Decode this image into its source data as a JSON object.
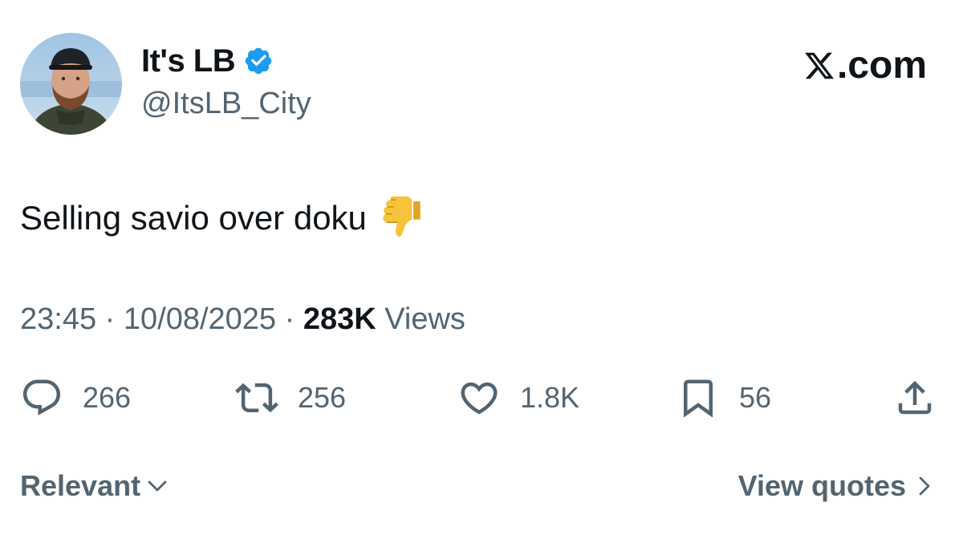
{
  "author": {
    "display_name": "It's LB",
    "handle": "@ItsLB_City",
    "verified": true,
    "avatar_icon": "profile-photo"
  },
  "brand": {
    "label": ".com",
    "logo_icon": "x-logo-icon"
  },
  "tweet": {
    "text": "Selling savio over doku",
    "emoji_icon": "thumbs-down-emoji-icon"
  },
  "meta": {
    "time": "23:45",
    "separator": "·",
    "date": "10/08/2025",
    "views_count": "283K",
    "views_label": "Views"
  },
  "actions": {
    "replies": "266",
    "reposts": "256",
    "likes": "1.8K",
    "bookmarks": "56"
  },
  "footer": {
    "sort_label": "Relevant",
    "view_quotes_label": "View quotes"
  },
  "colors": {
    "text_primary": "#0f1419",
    "text_secondary": "#536471",
    "verified_blue": "#1d9bf0",
    "background": "#ffffff"
  }
}
